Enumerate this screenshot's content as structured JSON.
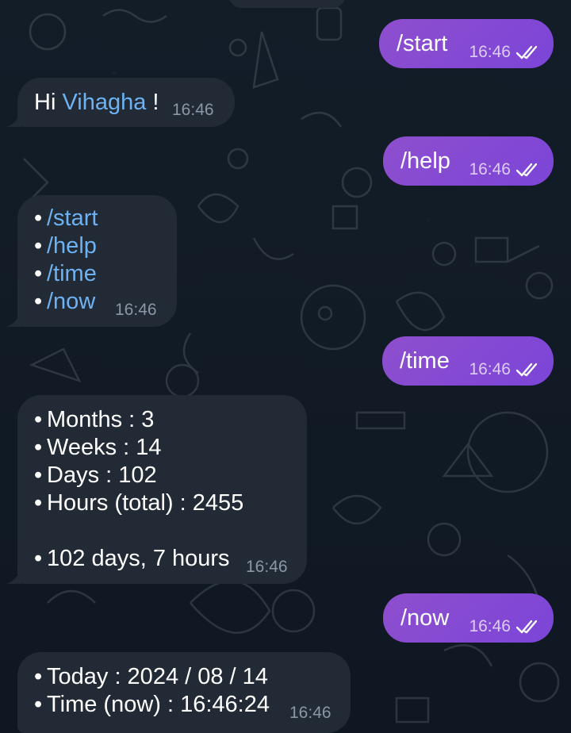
{
  "messages": [
    {
      "id": "m1",
      "dir": "out",
      "text": "/start",
      "time": "16:46"
    },
    {
      "id": "m2",
      "dir": "in",
      "greeting": "Hi",
      "name": "Vihagha",
      "suffix": "!",
      "time": "16:46"
    },
    {
      "id": "m3",
      "dir": "out",
      "text": "/help",
      "time": "16:46"
    },
    {
      "id": "m4",
      "dir": "in",
      "commands": [
        "/start",
        "/help",
        "/time",
        "/now"
      ],
      "time": "16:46"
    },
    {
      "id": "m5",
      "dir": "out",
      "text": "/time",
      "time": "16:46"
    },
    {
      "id": "m6",
      "dir": "in",
      "lines": [
        "Months : 3",
        "Weeks : 14",
        "Days : 102",
        "Hours (total) : 2455",
        "102 days, 7 hours"
      ],
      "time": "16:46"
    },
    {
      "id": "m7",
      "dir": "out",
      "text": "/now",
      "time": "16:46"
    },
    {
      "id": "m8",
      "dir": "in",
      "lines": [
        "Today : 2024 / 08 / 14",
        "Time (now) : 16:46:24"
      ],
      "time": "16:46"
    }
  ],
  "bullet_char": "•",
  "icons": {
    "read_receipt": "double-check-icon"
  },
  "colors": {
    "outgoing_bubble": "#8a4fd1",
    "incoming_bubble": "#212a35",
    "link": "#6db2f2",
    "background": "#111a24"
  }
}
